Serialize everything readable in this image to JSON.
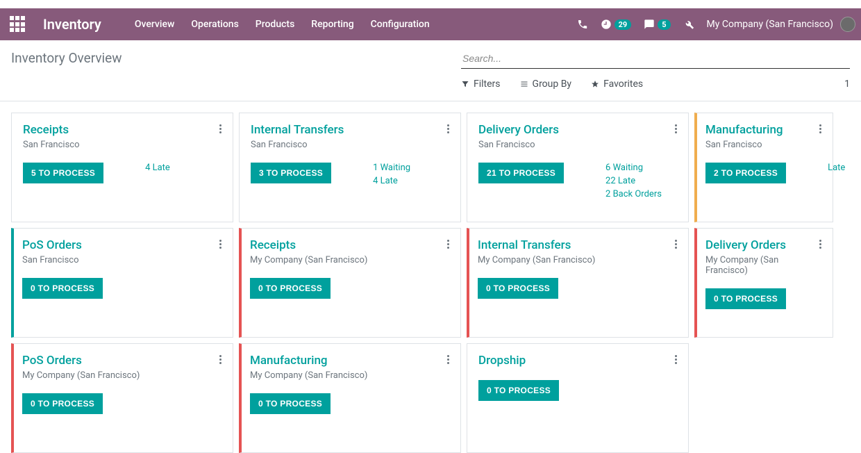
{
  "topbar": {
    "brand": "Inventory",
    "menu": [
      "Overview",
      "Operations",
      "Products",
      "Reporting",
      "Configuration"
    ],
    "clock_badge": "29",
    "chat_badge": "5",
    "company": "My Company (San Francisco)"
  },
  "page": {
    "title": "Inventory Overview",
    "search_placeholder": "Search...",
    "filters_label": "Filters",
    "groupby_label": "Group By",
    "favorites_label": "Favorites",
    "count_text": "1"
  },
  "cards": [
    {
      "title": "Receipts",
      "subtitle": "San Francisco",
      "button": "5 TO PROCESS",
      "accent": "",
      "statuses": [
        "4 Late"
      ]
    },
    {
      "title": "Internal Transfers",
      "subtitle": "San Francisco",
      "button": "3 TO PROCESS",
      "accent": "",
      "statuses": [
        "1 Waiting",
        "4 Late"
      ]
    },
    {
      "title": "Delivery Orders",
      "subtitle": "San Francisco",
      "button": "21 TO PROCESS",
      "accent": "",
      "statuses": [
        "6 Waiting",
        "22 Late",
        "2 Back Orders"
      ]
    },
    {
      "title": "Manufacturing",
      "subtitle": "San Francisco",
      "button": "2 TO PROCESS",
      "accent": "yellow",
      "statuses": [
        "Late"
      ],
      "partial": true
    },
    {
      "title": "PoS Orders",
      "subtitle": "San Francisco",
      "button": "0 TO PROCESS",
      "accent": "teal",
      "statuses": []
    },
    {
      "title": "Receipts",
      "subtitle": "My Company (San Francisco)",
      "button": "0 TO PROCESS",
      "accent": "red",
      "statuses": []
    },
    {
      "title": "Internal Transfers",
      "subtitle": "My Company (San Francisco)",
      "button": "0 TO PROCESS",
      "accent": "red",
      "statuses": []
    },
    {
      "title": "Delivery Orders",
      "subtitle": "My Company (San Francisco)",
      "button": "0 TO PROCESS",
      "accent": "red",
      "statuses": [],
      "partial": true
    },
    {
      "title": "PoS Orders",
      "subtitle": "My Company (San Francisco)",
      "button": "0 TO PROCESS",
      "accent": "red",
      "statuses": []
    },
    {
      "title": "Manufacturing",
      "subtitle": "My Company (San Francisco)",
      "button": "0 TO PROCESS",
      "accent": "red",
      "statuses": []
    },
    {
      "title": "Dropship",
      "subtitle": "",
      "button": "0 TO PROCESS",
      "accent": "",
      "statuses": []
    }
  ]
}
